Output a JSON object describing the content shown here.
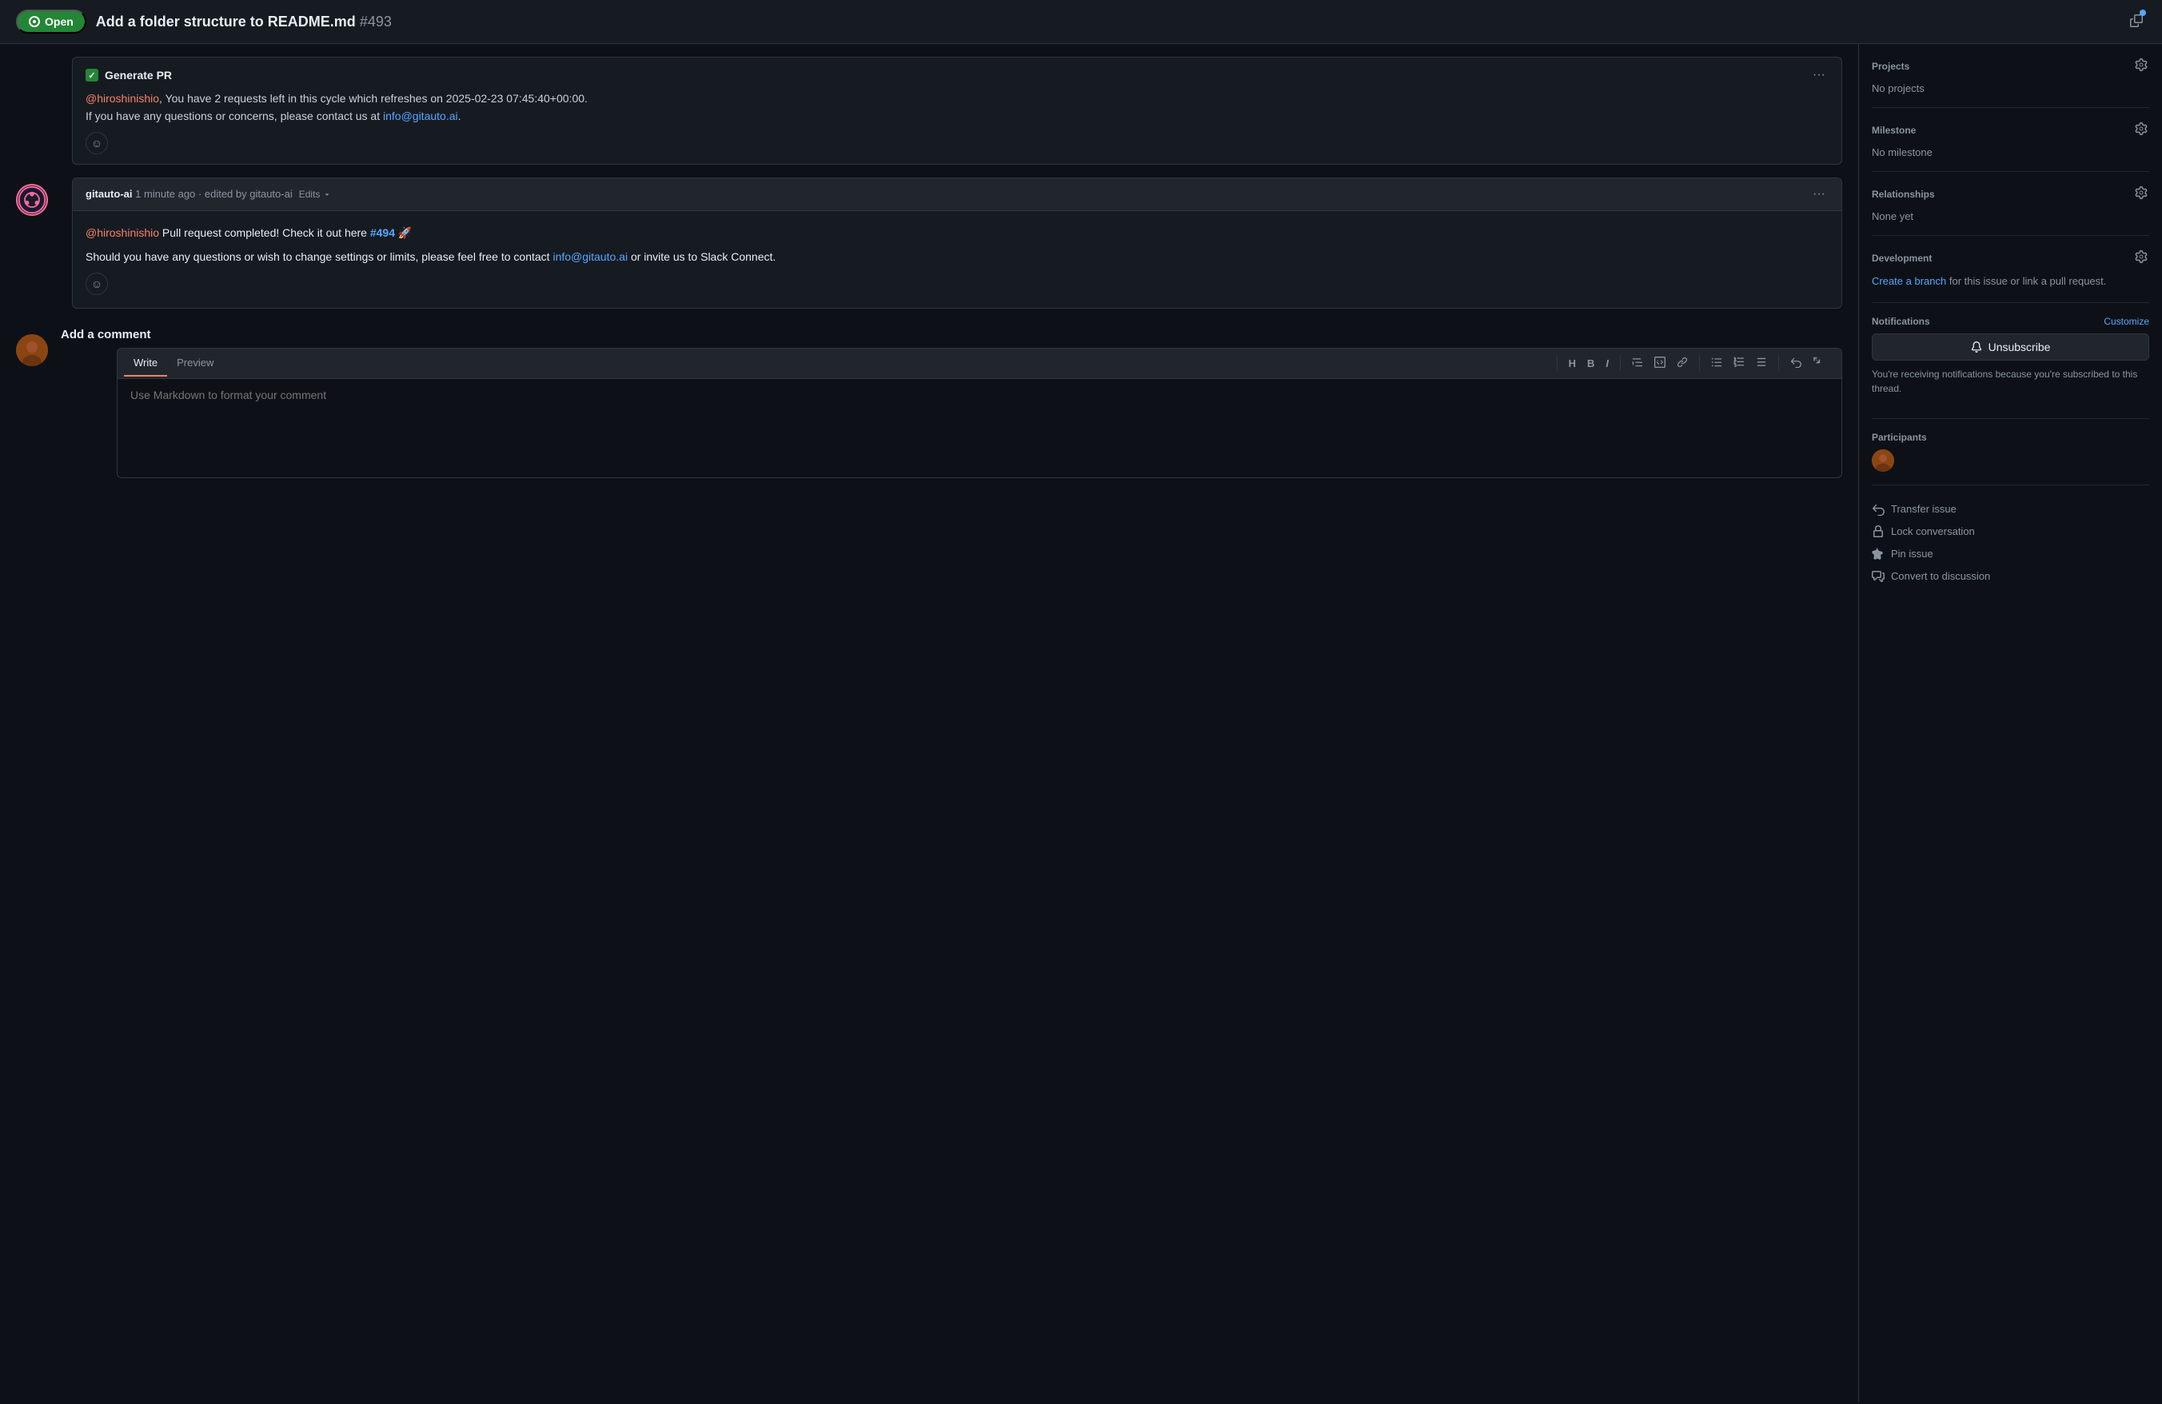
{
  "header": {
    "open_label": "Open",
    "title": "Add a folder structure to README.md",
    "issue_number": "#493"
  },
  "comment1": {
    "checkbox_label": "Generate PR",
    "notification_mention": "@hiroshinishio",
    "notification_text": ", You have 2 requests left in this cycle which refreshes on 2025-02-23 07:45:40+00:00.",
    "notification_contact": "If you have any questions or concerns, please contact us at ",
    "contact_email": "info@gitauto.ai",
    "contact_suffix": "."
  },
  "comment2": {
    "author": "gitauto-ai",
    "time": "1 minute ago",
    "edited": "· edited by gitauto-ai",
    "edits_label": "Edits",
    "mention": "@hiroshinishio",
    "body1": " Pull request completed! Check it out here ",
    "pr_link": "#494",
    "pr_emoji": "🚀",
    "body2": "Should you have any questions or wish to change settings or limits, please feel free to contact ",
    "email": "info@gitauto.ai",
    "body3": " or invite us to Slack Connect."
  },
  "add_comment": {
    "title": "Add a comment",
    "write_tab": "Write",
    "preview_tab": "Preview",
    "placeholder": "Use Markdown to format your comment",
    "toolbar": {
      "h": "H",
      "b": "B",
      "i": "I",
      "quote": "❝",
      "code": "<>",
      "link": "🔗",
      "ul": "≡",
      "ol": "≡",
      "tasklist": "☑",
      "undo": "↩",
      "expand": "⤢"
    }
  },
  "sidebar": {
    "projects": {
      "title": "Projects",
      "value": "No projects",
      "gear_label": "gear"
    },
    "milestone": {
      "title": "Milestone",
      "value": "No milestone",
      "gear_label": "gear"
    },
    "relationships": {
      "title": "Relationships",
      "value": "None yet",
      "gear_label": "gear"
    },
    "development": {
      "title": "Development",
      "create_branch_label": "Create a branch",
      "create_branch_text": " for this issue or link a pull request.",
      "gear_label": "gear"
    },
    "notifications": {
      "title": "Notifications",
      "customize_label": "Customize",
      "unsubscribe_label": "Unsubscribe",
      "note": "You're receiving notifications because you're subscribed to this thread."
    },
    "participants": {
      "title": "Participants"
    },
    "actions": {
      "transfer_label": "Transfer issue",
      "lock_label": "Lock conversation",
      "pin_label": "Pin issue",
      "convert_label": "Convert to discussion"
    }
  }
}
